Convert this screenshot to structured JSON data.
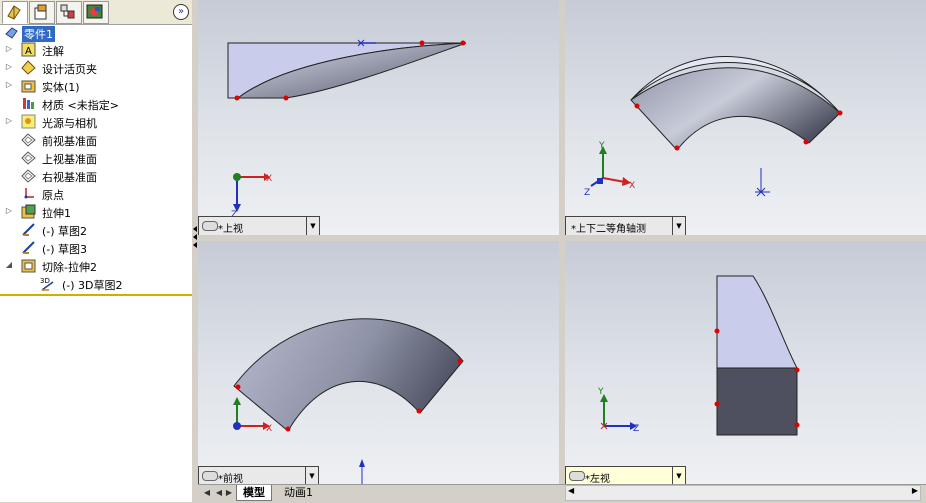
{
  "panel_tabs": [
    {
      "icon": "feature-manager-icon"
    },
    {
      "icon": "property-manager-icon"
    },
    {
      "icon": "configuration-manager-icon"
    },
    {
      "icon": "display-manager-icon"
    }
  ],
  "expand_glyph": "»",
  "tree": {
    "root": "零件1",
    "items": [
      {
        "label": "注解",
        "expander": "▷",
        "icon": "annotation-icon"
      },
      {
        "label": "设计活页夹",
        "expander": "▷",
        "icon": "design-binder-icon"
      },
      {
        "label": "实体(1)",
        "expander": "▷",
        "icon": "solid-bodies-icon"
      },
      {
        "label": "材质 <未指定>",
        "expander": "",
        "icon": "material-icon"
      },
      {
        "label": "光源与相机",
        "expander": "▷",
        "icon": "lights-cameras-icon"
      },
      {
        "label": "前视基准面",
        "expander": "",
        "icon": "plane-icon"
      },
      {
        "label": "上视基准面",
        "expander": "",
        "icon": "plane-icon"
      },
      {
        "label": "右视基准面",
        "expander": "",
        "icon": "plane-icon"
      },
      {
        "label": "原点",
        "expander": "",
        "icon": "origin-icon"
      },
      {
        "label": "拉伸1",
        "expander": "▷",
        "icon": "extrude-icon"
      },
      {
        "label": "(-) 草图2",
        "expander": "",
        "icon": "sketch-icon"
      },
      {
        "label": "(-) 草图3",
        "expander": "",
        "icon": "sketch-icon"
      },
      {
        "label": "切除-拉伸2",
        "expander": "◢",
        "icon": "cut-extrude-icon"
      },
      {
        "label": "(-) 3D草图2",
        "expander": "",
        "icon": "3d-sketch-icon"
      }
    ]
  },
  "views": {
    "top": "*上视",
    "trimetric": "*上下二等角轴测",
    "front": "*前视",
    "left": "*左视"
  },
  "triad": {
    "x": "X",
    "y": "Y",
    "z": "Z"
  },
  "bottom_tabs": {
    "model": "模型",
    "motion": "动画1"
  },
  "nav_glyphs": {
    "first": "◀",
    "prev": "◀",
    "next": "▶",
    "last": "▶"
  },
  "colors": {
    "selection": "#316ac5",
    "rollback": "#c8b400",
    "vertex_point": "#e00000",
    "axis_x": "#d02020",
    "axis_y": "#208020",
    "axis_z": "#2030c0"
  }
}
